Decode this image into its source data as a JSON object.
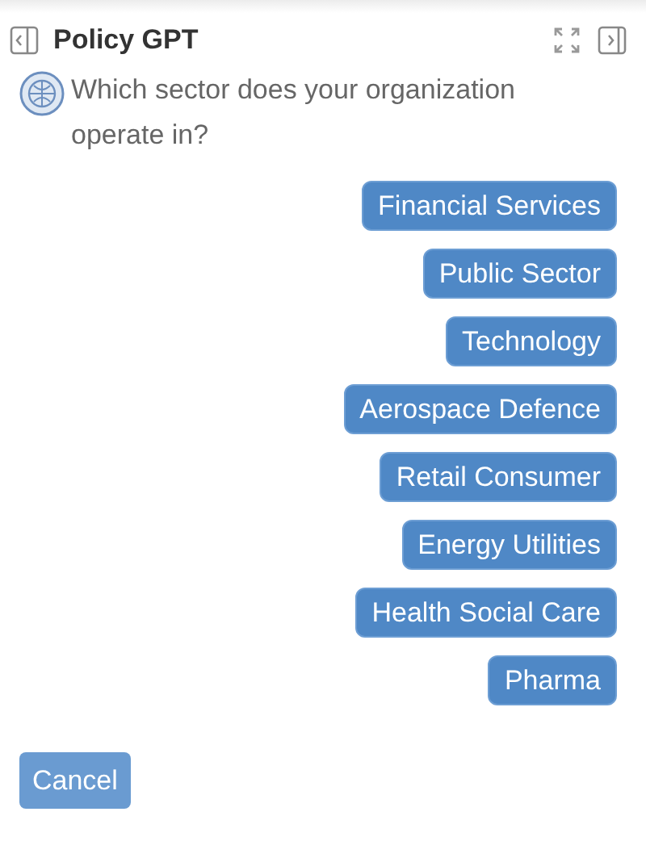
{
  "header": {
    "title": "Policy GPT"
  },
  "message": {
    "text": "Which sector does your organization operate in?"
  },
  "options": [
    {
      "label": "Financial Services"
    },
    {
      "label": "Public Sector"
    },
    {
      "label": "Technology"
    },
    {
      "label": "Aerospace Defence"
    },
    {
      "label": "Retail Consumer"
    },
    {
      "label": "Energy Utilities"
    },
    {
      "label": "Health Social Care"
    },
    {
      "label": "Pharma"
    }
  ],
  "cancel_button": {
    "label": "Cancel"
  }
}
